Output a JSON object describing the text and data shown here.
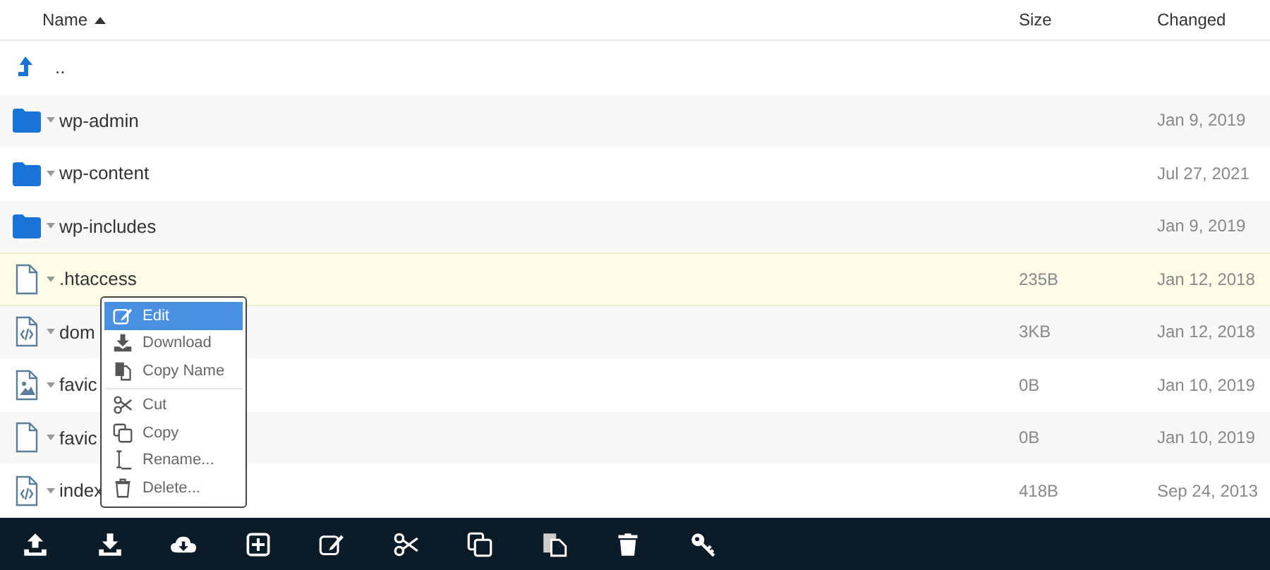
{
  "table": {
    "columns": [
      {
        "label": "Name",
        "sorted_ascending": true
      },
      {
        "label": "Size"
      },
      {
        "label": "Changed"
      }
    ],
    "rows": [
      {
        "kind": "parent",
        "name": "..",
        "selected": false
      },
      {
        "kind": "folder",
        "name": "wp-admin",
        "size": "",
        "changed": "Jan 9, 2019",
        "selected": false
      },
      {
        "kind": "folder",
        "name": "wp-content",
        "size": "",
        "changed": "Jul 27, 2021",
        "selected": false
      },
      {
        "kind": "folder",
        "name": "wp-includes",
        "size": "",
        "changed": "Jan 9, 2019",
        "selected": false
      },
      {
        "kind": "file",
        "name": ".htaccess",
        "size": "235B",
        "changed": "Jan 12, 2018",
        "selected": true
      },
      {
        "kind": "code",
        "name": "dom",
        "size": "3KB",
        "changed": "Jan 12, 2018",
        "selected": false
      },
      {
        "kind": "image",
        "name": "favic",
        "size": "0B",
        "changed": "Jan 10, 2019",
        "selected": false
      },
      {
        "kind": "file",
        "name": "favic",
        "size": "0B",
        "changed": "Jan 10, 2019",
        "selected": false
      },
      {
        "kind": "code",
        "name": "index",
        "size": "418B",
        "changed": "Sep 24, 2013",
        "selected": false
      }
    ]
  },
  "context_menu": {
    "items": [
      {
        "kind": "edit",
        "label": "Edit",
        "selected": true
      },
      {
        "kind": "download",
        "label": "Download",
        "selected": false
      },
      {
        "kind": "copyname",
        "label": "Copy Name",
        "selected": false
      },
      {
        "kind": "separator"
      },
      {
        "kind": "cut",
        "label": "Cut",
        "selected": false
      },
      {
        "kind": "copy",
        "label": "Copy",
        "selected": false
      },
      {
        "kind": "rename",
        "label": "Rename...",
        "selected": false
      },
      {
        "kind": "delete",
        "label": "Delete...",
        "selected": false
      }
    ]
  },
  "toolbar": {
    "buttons": [
      {
        "kind": "upload"
      },
      {
        "kind": "download"
      },
      {
        "kind": "cloud"
      },
      {
        "kind": "add"
      },
      {
        "kind": "edit"
      },
      {
        "kind": "cut"
      },
      {
        "kind": "copy"
      },
      {
        "kind": "paste"
      },
      {
        "kind": "delete"
      },
      {
        "kind": "key"
      }
    ]
  }
}
